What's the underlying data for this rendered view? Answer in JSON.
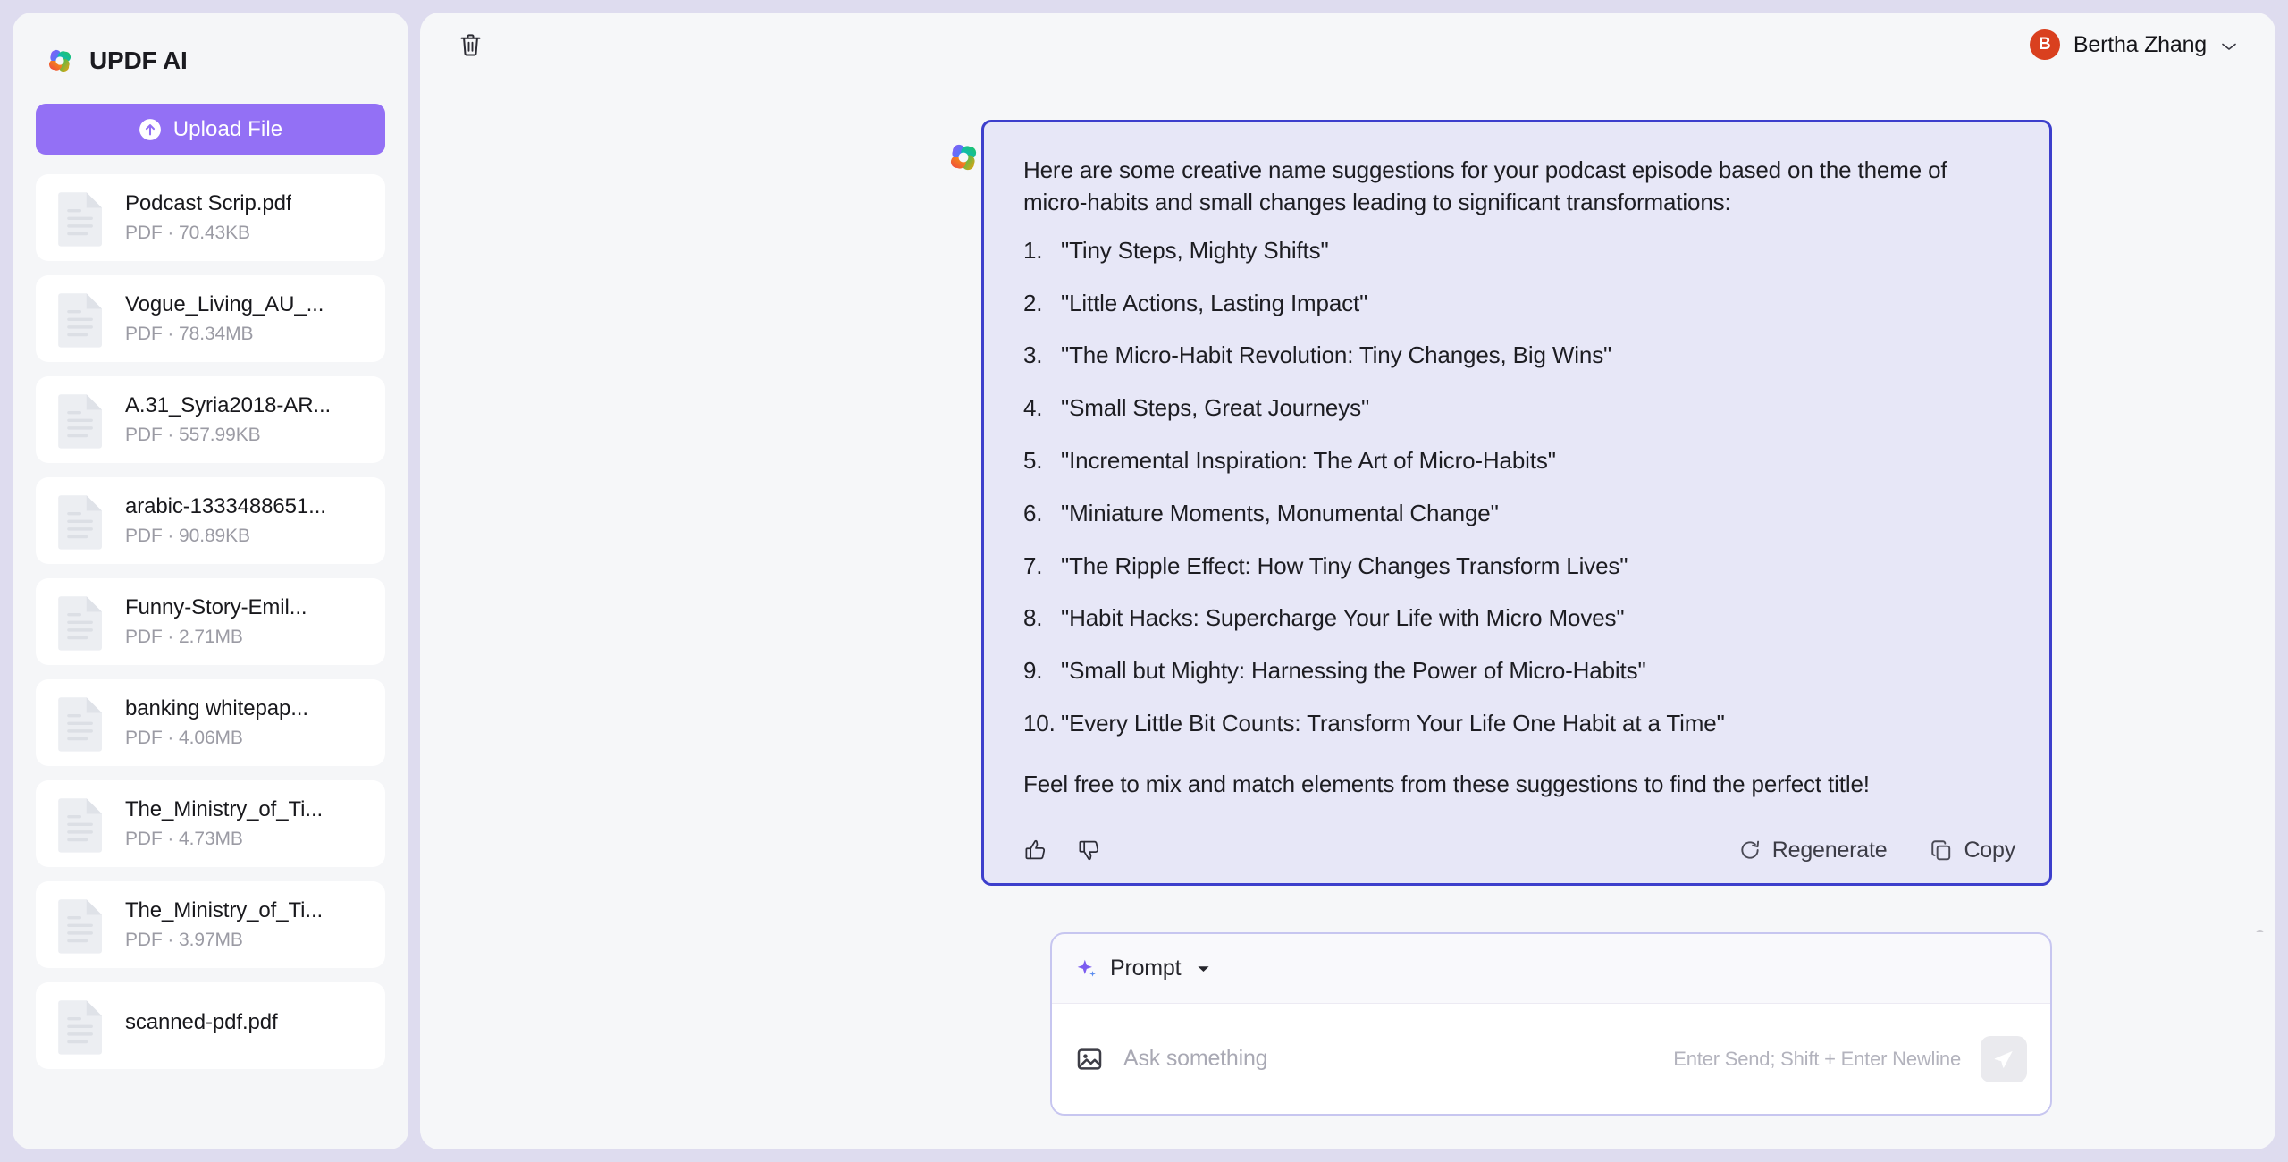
{
  "brand": {
    "name": "UPDF AI",
    "logo_icon": "updf-clover-logo"
  },
  "sidebar": {
    "upload_button": {
      "label": "Upload File",
      "icon": "upload-arrow-icon"
    },
    "files": [
      {
        "name": "Podcast Scrip.pdf",
        "meta": "PDF · 70.43KB",
        "icon": "pdf-file-icon"
      },
      {
        "name": "Vogue_Living_AU_...",
        "meta": "PDF · 78.34MB",
        "icon": "pdf-file-icon"
      },
      {
        "name": "A.31_Syria2018-AR...",
        "meta": "PDF · 557.99KB",
        "icon": "pdf-file-icon"
      },
      {
        "name": "arabic-1333488651...",
        "meta": "PDF · 90.89KB",
        "icon": "pdf-file-icon"
      },
      {
        "name": "Funny-Story-Emil...",
        "meta": "PDF · 2.71MB",
        "icon": "pdf-file-icon"
      },
      {
        "name": "banking whitepap...",
        "meta": "PDF · 4.06MB",
        "icon": "pdf-file-icon"
      },
      {
        "name": "The_Ministry_of_Ti...",
        "meta": "PDF · 4.73MB",
        "icon": "pdf-file-icon"
      },
      {
        "name": "The_Ministry_of_Ti...",
        "meta": "PDF · 3.97MB",
        "icon": "pdf-file-icon"
      },
      {
        "name": "scanned-pdf.pdf",
        "meta": "",
        "icon": "pdf-file-icon"
      }
    ]
  },
  "topbar": {
    "delete_icon": "trash-icon",
    "user": {
      "initial": "B",
      "name": "Bertha Zhang",
      "chevron_icon": "chevron-down-icon"
    }
  },
  "answer": {
    "avatar_icon": "updf-clover-logo",
    "intro": "Here are some creative name suggestions for your podcast episode based on the theme of micro-habits and small changes leading to significant transformations:",
    "items": [
      {
        "num": "1.",
        "text": "\"Tiny Steps, Mighty Shifts\""
      },
      {
        "num": "2.",
        "text": "\"Little Actions, Lasting Impact\""
      },
      {
        "num": "3.",
        "text": "\"The Micro-Habit Revolution: Tiny Changes, Big Wins\""
      },
      {
        "num": "4.",
        "text": "\"Small Steps, Great Journeys\""
      },
      {
        "num": "5.",
        "text": "\"Incremental Inspiration: The Art of Micro-Habits\""
      },
      {
        "num": "6.",
        "text": "\"Miniature Moments, Monumental Change\""
      },
      {
        "num": "7.",
        "text": "\"The Ripple Effect: How Tiny Changes Transform Lives\""
      },
      {
        "num": "8.",
        "text": "\"Habit Hacks: Supercharge Your Life with Micro Moves\""
      },
      {
        "num": "9.",
        "text": "\"Small but Mighty: Harnessing the Power of Micro-Habits\""
      },
      {
        "num": "10.",
        "text": "\"Every Little Bit Counts: Transform Your Life One Habit at a Time\""
      }
    ],
    "closing": "Feel free to mix and match elements from these suggestions to find the perfect title!",
    "actions": {
      "thumbs_up_icon": "thumbs-up-icon",
      "thumbs_down_icon": "thumbs-down-icon",
      "regenerate_label": "Regenerate",
      "regenerate_icon": "refresh-icon",
      "copy_label": "Copy",
      "copy_icon": "copy-icon"
    }
  },
  "composer": {
    "prompt_label": "Prompt",
    "prompt_icon": "sparkle-icon",
    "caret_icon": "caret-down-icon",
    "attach_icon": "image-icon",
    "input_value": "",
    "placeholder": "Ask something",
    "hint": "Enter Send; Shift + Enter Newline",
    "send_icon": "send-plane-icon"
  },
  "colors": {
    "page_background": "#dedcef",
    "panel": "#f5f6f8",
    "accent_purple": "#9370f5",
    "answer_border": "#3d3fcc",
    "answer_background": "#e7e7f7",
    "avatar_red": "#d9401f"
  }
}
